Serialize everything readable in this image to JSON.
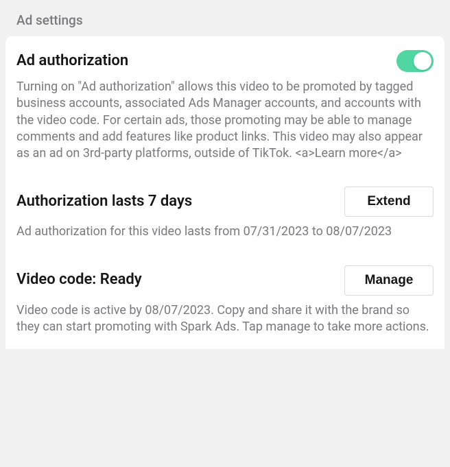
{
  "header": {
    "title": "Ad settings"
  },
  "sections": {
    "authorization": {
      "title": "Ad authorization",
      "description": "Turning on \"Ad authorization\" allows this video to be promoted by tagged business accounts, associated Ads Manager accounts, and accounts with the video code. For certain ads, those promoting may be able to manage comments and add features like product links. This video may also appear as an ad on 3rd-party platforms, outside of TikTok. ",
      "learn_more_raw": "<a>Learn more</a>",
      "toggle_on": true
    },
    "duration": {
      "title": "Authorization lasts 7 days",
      "button_label": "Extend",
      "description": "Ad authorization for this video lasts from 07/31/2023 to 08/07/2023"
    },
    "video_code": {
      "title": "Video code: Ready",
      "button_label": "Manage",
      "description": "Video code is active by 08/07/2023. Copy and share it with the brand so they can start promoting with Spark Ads. Tap manage to take more actions."
    }
  }
}
